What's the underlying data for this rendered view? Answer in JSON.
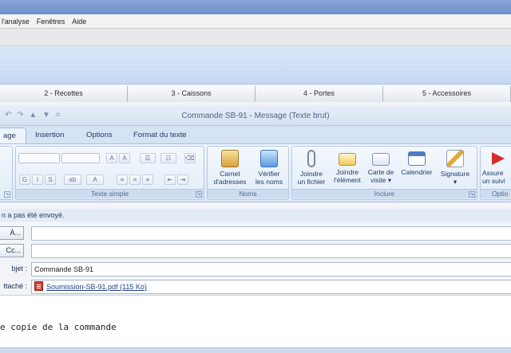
{
  "menu": {
    "items": [
      "l'analyse",
      "Fenêtres",
      "Aide"
    ]
  },
  "window_tabs": [
    "2 - Recettes",
    "3 - Caissons",
    "4 - Portes",
    "5 - Accessoires"
  ],
  "message_window": {
    "title": "Commande SB-91 - Message (Texte brut)",
    "qat": "↶ ↷ ▲ ▼ ="
  },
  "ribbon_tabs": [
    "age",
    "Insertion",
    "Options",
    "Format du texte"
  ],
  "ribbon": {
    "groups": {
      "basic_text": "Texte simple",
      "names": "Noms",
      "include": "Inclure",
      "options": "Optio"
    },
    "buttons": {
      "address_book": [
        "Carnet",
        "d'adresses"
      ],
      "check_names": [
        "Vérifier",
        "les noms"
      ],
      "attach_file": [
        "Joindre",
        "un fichier"
      ],
      "attach_item": [
        "Joindre",
        "l'élément"
      ],
      "business_card": [
        "Carte de",
        "visite ▾"
      ],
      "calendar": [
        "Calendrier",
        ""
      ],
      "signature": [
        "Signature",
        "▾"
      ],
      "follow_up": [
        "Assure",
        "un suivi"
      ]
    },
    "format_glyphs": {
      "grow": "A",
      "shrink": "A",
      "bullets": "☰",
      "numbering": "☷",
      "clear": "⌫",
      "bold": "G",
      "italic": "I",
      "underline": "S",
      "highlight": "ab",
      "color": "A",
      "align_left": "≡",
      "align_center": "≡",
      "align_right": "≡",
      "outdent": "⇤",
      "indent": "⇥"
    }
  },
  "notice": "n a pas été envoyé.",
  "fields": {
    "to_button": "À...",
    "cc_button": "Cc...",
    "subject_label": "bjet :",
    "subject_value": "Commande SB-91",
    "attached_label": "ttaché :",
    "attachment": "Soumission-SB-91.pdf (115 Ko)"
  },
  "body_text": "e copie de la commande",
  "colors": {
    "accent_blue": "#c6d9f3",
    "ribbon_bg": "#dbe7f6",
    "pdf_red": "#d63a2c"
  }
}
